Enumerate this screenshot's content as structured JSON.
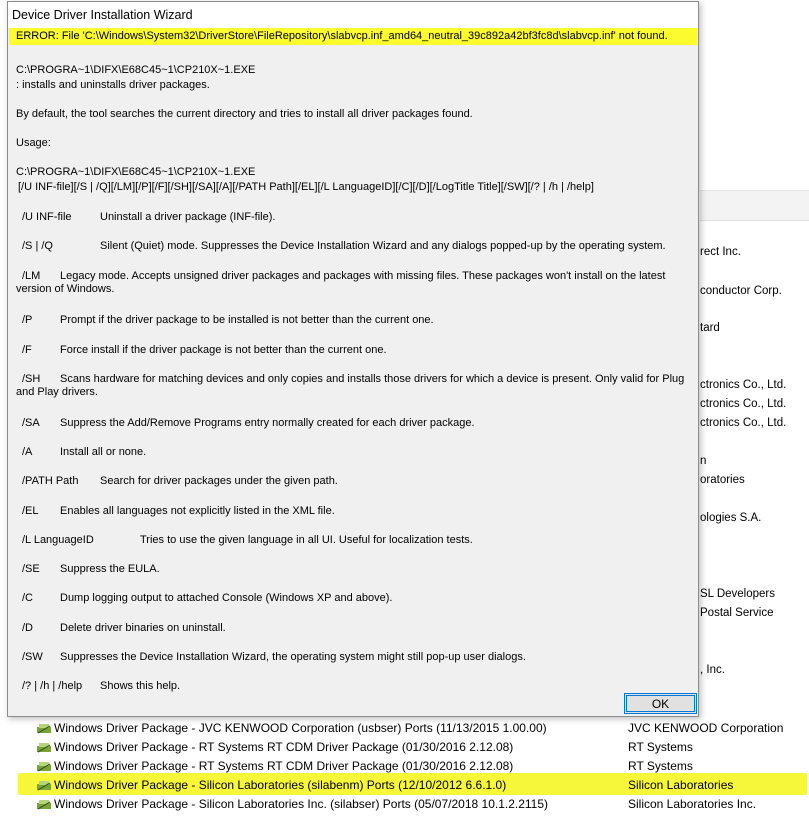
{
  "background": {
    "publisher_snippets": [
      "rect Inc.",
      "conductor Corp.",
      "tard",
      "ctronics Co., Ltd.",
      "ctronics Co., Ltd.",
      "ctronics Co., Ltd.",
      "n",
      "oratories",
      "ologies S.A.",
      "SL Developers",
      "Postal Service",
      ", Inc."
    ],
    "program_rows": [
      {
        "name": "Windows Driver Package - JVC KENWOOD Corporation (usbser) Ports  (11/13/2015 1.00.00)",
        "publisher": "JVC KENWOOD Corporation"
      },
      {
        "name": "Windows Driver Package - RT Systems RT CDM Driver Package (01/30/2016 2.12.08)",
        "publisher": "RT Systems"
      },
      {
        "name": "Windows Driver Package - RT Systems RT CDM Driver Package (01/30/2016 2.12.08)",
        "publisher": "RT Systems"
      },
      {
        "name": "Windows Driver Package - Silicon Laboratories (silabenm) Ports  (12/10/2012 6.6.1.0)",
        "publisher": "Silicon Laboratories"
      },
      {
        "name": "Windows Driver Package - Silicon Laboratories Inc. (silabser) Ports  (05/07/2018 10.1.2.2115)",
        "publisher": "Silicon Laboratories Inc."
      }
    ]
  },
  "dialog": {
    "title": "Device Driver Installation Wizard",
    "error": "ERROR: File 'C:\\Windows\\System32\\DriverStore\\FileRepository\\slabvcp.inf_amd64_neutral_39c892a42bf3fc8d\\slabvcp.inf' not found.",
    "exe_path": "C:\\PROGRA~1\\DIFX\\E68C45~1\\CP210X~1.EXE",
    "summary": ": installs and uninstalls driver packages.",
    "default_behavior": "By default, the tool searches the current directory and tries to install all driver packages found.",
    "usage_label": "Usage:",
    "usage_exe": "C:\\PROGRA~1\\DIFX\\E68C45~1\\CP210X~1.EXE",
    "usage_syntax": "[/U INF-file][/S | /Q][/LM][/P][/F][/SH][/SA][/A][/PATH Path][/EL][/L LanguageID][/C][/D][/LogTitle Title][/SW][/? | /h | /help]",
    "options": [
      {
        "flag": "/U INF-file",
        "desc": "Uninstall a driver package (INF-file)."
      },
      {
        "flag": "/S | /Q",
        "desc": "Silent (Quiet) mode. Suppresses the Device Installation Wizard and any dialogs popped-up by the operating system."
      },
      {
        "flag": "/LM",
        "desc": "Legacy mode. Accepts unsigned driver packages and packages with missing files. These packages won't install on the latest version of Windows."
      },
      {
        "flag": "/P",
        "desc": "Prompt if the driver package to be installed is not better than the current one."
      },
      {
        "flag": "/F",
        "desc": "Force install if the driver package is not better than the current one."
      },
      {
        "flag": "/SH",
        "desc": "Scans hardware for matching devices and only copies and installs those drivers for which a device is present. Only valid for Plug and Play drivers."
      },
      {
        "flag": "/SA",
        "desc": "Suppress the Add/Remove Programs entry normally created for each driver package."
      },
      {
        "flag": "/A",
        "desc": "Install all or none."
      },
      {
        "flag": "/PATH Path",
        "desc": "Search for driver packages under the given path."
      },
      {
        "flag": "/EL",
        "desc": "Enables all languages not explicitly listed in the XML file."
      },
      {
        "flag": "/L LanguageID",
        "desc": "Tries to use the given language in all UI. Useful for localization tests."
      },
      {
        "flag": "/SE",
        "desc": "Suppress the EULA."
      },
      {
        "flag": "/C",
        "desc": "Dump logging output to attached Console (Windows XP and above)."
      },
      {
        "flag": "/D",
        "desc": "Delete driver binaries on uninstall."
      },
      {
        "flag": "/SW",
        "desc": "Suppresses the Device Installation Wizard, the operating system might still pop-up user dialogs."
      },
      {
        "flag": "/? | /h | /help",
        "desc": "Shows this help."
      }
    ],
    "ok_label": "OK"
  },
  "colors": {
    "highlight": "#f7f73a",
    "dialog_bg": "#f0f0f0",
    "button_border": "#0078d7"
  }
}
